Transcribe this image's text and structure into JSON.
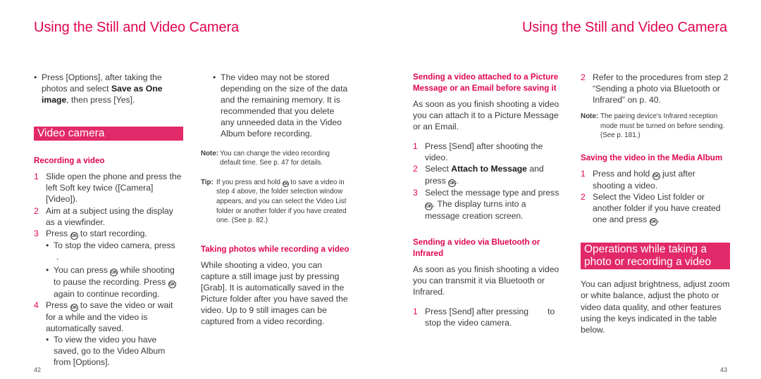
{
  "left_page": {
    "title": "Using the Still and Video Camera",
    "page_number": "42",
    "intro_bullet": {
      "pre": "Press [Options], after taking the photos and select ",
      "bold": "Save as One image",
      "post": ", then press [Yes]."
    },
    "section_band": "Video camera",
    "recording": {
      "heading": "Recording a video",
      "steps": [
        {
          "num": "1",
          "text": "Slide open the phone and press the left Soft key twice ([Camera] [Video])."
        },
        {
          "num": "2",
          "text": "Aim at a subject using the display as a viewfinder."
        },
        {
          "num": "3",
          "pre": "Press ",
          "post": " to start recording."
        }
      ],
      "sub_bullets_3": [
        {
          "text": "To stop the video camera, press",
          "cont": "."
        },
        {
          "pre": "You can press ",
          "mid": " while shooting to pause the recording. Press ",
          "post": " again to continue recording."
        }
      ],
      "step4": {
        "num": "4",
        "pre": "Press ",
        "post": " to save the video or wait for a while and the video is automatically saved."
      },
      "sub_bullet_4": "To view the video you have saved, go to the Video Album from [Options]."
    },
    "col2": {
      "bullet": "The video may not be stored depending on the size of the data and the remaining memory. It is recommended that you delete any unneeded data in the Video Album before recording.",
      "note_label": "Note:",
      "note_text": "You can change the video recording default time. See p. 47 for details.",
      "tip_label": "Tip:",
      "tip_pre": "If you press and hold ",
      "tip_post": " to save a video in step 4 above, the folder selection window appears, and you can select the Video List folder or another folder if you have created one. (See p. 82.)",
      "heading": "Taking photos while recording a video",
      "para": "While shooting a video, you can capture a still image just by pressing [Grab]. It is automatically saved in the Picture folder after you have saved the video. Up to 9 still images can be captured from a video recording."
    }
  },
  "right_page": {
    "title": "Using the Still and Video Camera",
    "page_number": "43",
    "col3": {
      "heading1": "Sending a video attached to a Picture Message or an Email before saving it",
      "para1": "As soon as you finish shooting a video you can attach it to a Picture Message or an Email.",
      "steps1": [
        {
          "num": "1",
          "text": "Press [Send] after shooting the video."
        },
        {
          "num": "2",
          "pre": "Select ",
          "bold": "Attach to Message",
          "mid": " and press ",
          "post": "."
        },
        {
          "num": "3",
          "pre": "Select the message type and press ",
          "post": ". The display turns into a message creation screen."
        }
      ],
      "heading2": "Sending a video via Bluetooth or Infrared",
      "para2": "As soon as you finish shooting a video you can transmit it via Bluetooth or Infrared.",
      "step_bt1": {
        "num": "1",
        "text": "Press [Send] after pressing        to stop the video camera."
      }
    },
    "col4": {
      "step_bt2": {
        "num": "2",
        "text": "Refer to the procedures from step 2 “Sending a photo via Bluetooth or Infrared” on p. 40."
      },
      "note_label": "Note:",
      "note_text": "The pairing device's Infrared reception mode must be turned on before sending. (See p. 181.)",
      "heading": "Saving the video in the Media Album",
      "steps": [
        {
          "num": "1",
          "pre": "Press and hold ",
          "post": " just after shooting a video."
        },
        {
          "num": "2",
          "pre": "Select the Video List folder or another folder if you have created one and press ",
          "post": "."
        }
      ],
      "section_band": "Operations while taking a photo or recording a video",
      "para": "You can adjust brightness, adjust zoom or white balance, adjust the photo or video data quality, and other features using the keys indicated in the table below."
    }
  },
  "icons": {
    "ok_key": "OK"
  },
  "colors": {
    "accent": "#e0064f",
    "band": "#e2296a",
    "text": "#3a3a3a"
  }
}
